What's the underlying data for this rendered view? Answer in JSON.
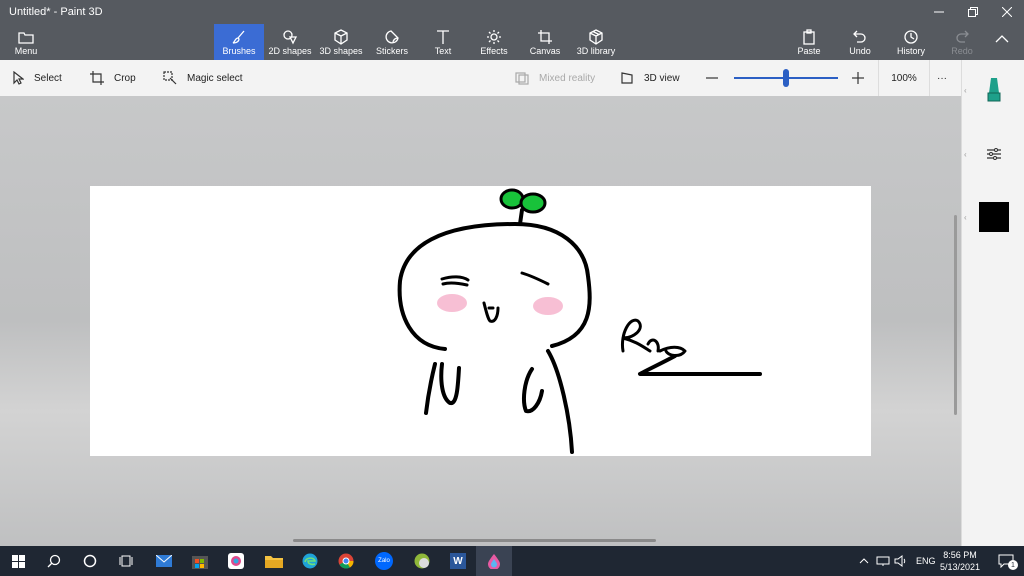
{
  "window": {
    "title": "Untitled* - Paint 3D"
  },
  "ribbon": {
    "menu_label": "Menu",
    "tools": [
      "Brushes",
      "2D shapes",
      "3D shapes",
      "Stickers",
      "Text",
      "Effects",
      "Canvas",
      "3D library"
    ],
    "active_tool": "Brushes",
    "paste_label": "Paste",
    "undo_label": "Undo",
    "history_label": "History",
    "redo_label": "Redo"
  },
  "toolbar": {
    "select_label": "Select",
    "crop_label": "Crop",
    "magic_select_label": "Magic select",
    "mixed_reality_label": "Mixed reality",
    "view3d_label": "3D view",
    "zoom_value": "100%",
    "zoom_fraction": 0.5,
    "more_label": "···"
  },
  "right_panel": {
    "current_color": "#000000",
    "brush_color": "#1ea08a"
  },
  "colors": {
    "accent": "#3b6cd4",
    "ribbon": "#565a60",
    "taskbar": "#1f2733"
  },
  "taskbar": {
    "icons": [
      "windows-start-icon",
      "search-icon",
      "cortana-icon",
      "task-view-icon",
      "mail-icon",
      "store-icon",
      "photos-icon",
      "file-explorer-icon",
      "edge-icon",
      "chrome-icon",
      "zalo-icon",
      "app-icon",
      "word-icon",
      "paint3d-icon"
    ],
    "zalo_text": "Zalo",
    "word_text": "W",
    "tray_lang": "ENG",
    "time": "8:56 PM",
    "date": "5/13/2021",
    "notification_count": "1"
  }
}
